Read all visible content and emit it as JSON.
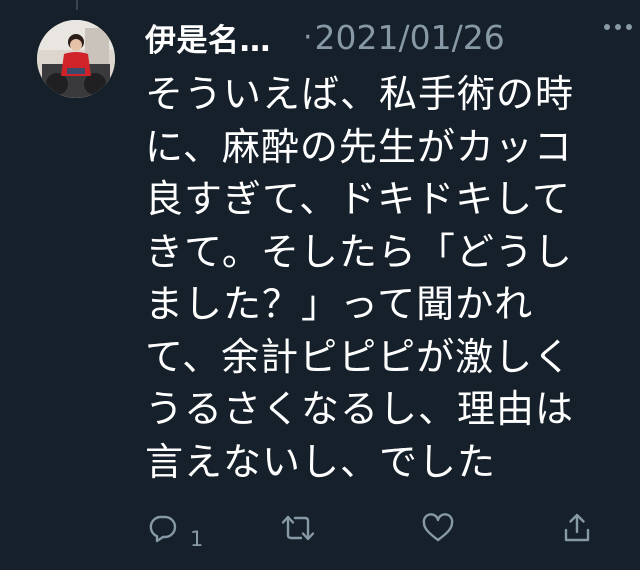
{
  "tweet": {
    "author_name": "伊是名…",
    "meta_separator": "·",
    "date": "2021/01/26",
    "lines": [
      "そういえば、私手術の時",
      "に、麻酔の先生がカッコ",
      "良すぎて、ドキドキして",
      "きて。そしたら「どうし",
      "ました？」って聞かれ",
      "て、余計ピピピが激しく",
      "うるさくなるし、理由は",
      "言えないし、でした"
    ]
  },
  "actions": {
    "reply_icon": "reply-icon",
    "reply_count": "1",
    "retweet_icon": "retweet-icon",
    "like_icon": "heart-icon",
    "share_icon": "share-icon"
  },
  "icons": {
    "more": "more-horizontal-icon",
    "avatar": "avatar"
  },
  "colors": {
    "background": "#15202b",
    "text_primary": "#ffffff",
    "text_secondary": "#8899a6"
  }
}
